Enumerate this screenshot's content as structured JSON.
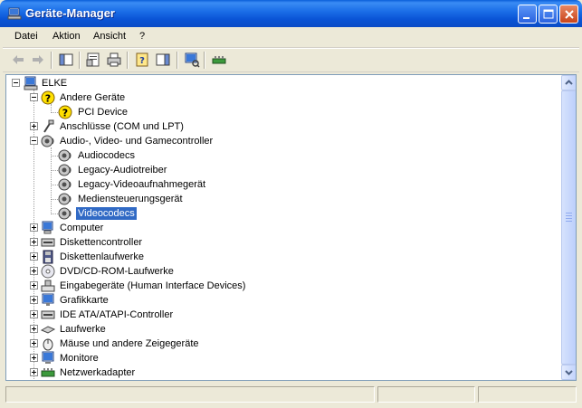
{
  "window": {
    "title": "Geräte-Manager"
  },
  "menu": [
    {
      "label": "Datei"
    },
    {
      "label": "Aktion"
    },
    {
      "label": "Ansicht"
    },
    {
      "label": "?"
    }
  ],
  "toolbar": {
    "buttons": [
      {
        "name": "back-icon"
      },
      {
        "name": "forward-icon"
      },
      {
        "name": "show-hide-console-tree-icon"
      },
      {
        "name": "properties-icon"
      },
      {
        "name": "print-icon"
      },
      {
        "name": "help-icon"
      },
      {
        "name": "show-hide-action-pane-icon"
      },
      {
        "name": "scan-hardware-changes-icon"
      },
      {
        "name": "update-driver-icon"
      }
    ]
  },
  "tree": {
    "root": {
      "label": "ELKE",
      "icon": "computer-icon",
      "expanded": true
    },
    "nodes": [
      {
        "label": "Andere Geräte",
        "icon": "unknown-device-icon",
        "level": 1,
        "expanded": true,
        "has_children": true
      },
      {
        "label": "PCI Device",
        "icon": "unknown-device-icon",
        "level": 2
      },
      {
        "label": "Anschlüsse (COM und LPT)",
        "icon": "port-icon",
        "level": 1,
        "expanded": false,
        "has_children": true
      },
      {
        "label": "Audio-, Video- und Gamecontroller",
        "icon": "sound-icon",
        "level": 1,
        "expanded": true,
        "has_children": true
      },
      {
        "label": "Audiocodecs",
        "icon": "sound-icon",
        "level": 2
      },
      {
        "label": "Legacy-Audiotreiber",
        "icon": "sound-icon",
        "level": 2
      },
      {
        "label": "Legacy-Videoaufnahmegerät",
        "icon": "sound-icon",
        "level": 2
      },
      {
        "label": "Mediensteuerungsgerät",
        "icon": "sound-icon",
        "level": 2
      },
      {
        "label": "Videocodecs",
        "icon": "sound-icon",
        "level": 2,
        "selected": true
      },
      {
        "label": "Computer",
        "icon": "computer-small-icon",
        "level": 1,
        "expanded": false,
        "has_children": true
      },
      {
        "label": "Diskettencontroller",
        "icon": "floppy-controller-icon",
        "level": 1,
        "expanded": false,
        "has_children": true
      },
      {
        "label": "Diskettenlaufwerke",
        "icon": "floppy-drive-icon",
        "level": 1,
        "expanded": false,
        "has_children": true
      },
      {
        "label": "DVD/CD-ROM-Laufwerke",
        "icon": "cdrom-icon",
        "level": 1,
        "expanded": false,
        "has_children": true
      },
      {
        "label": "Eingabegeräte (Human Interface Devices)",
        "icon": "hid-icon",
        "level": 1,
        "expanded": false,
        "has_children": true
      },
      {
        "label": "Grafikkarte",
        "icon": "display-adapter-icon",
        "level": 1,
        "expanded": false,
        "has_children": true
      },
      {
        "label": "IDE ATA/ATAPI-Controller",
        "icon": "ide-controller-icon",
        "level": 1,
        "expanded": false,
        "has_children": true
      },
      {
        "label": "Laufwerke",
        "icon": "disk-drive-icon",
        "level": 1,
        "expanded": false,
        "has_children": true
      },
      {
        "label": "Mäuse und andere Zeigegeräte",
        "icon": "mouse-icon",
        "level": 1,
        "expanded": false,
        "has_children": true
      },
      {
        "label": "Monitore",
        "icon": "monitor-icon",
        "level": 1,
        "expanded": false,
        "has_children": true
      },
      {
        "label": "Netzwerkadapter",
        "icon": "network-adapter-icon",
        "level": 1,
        "expanded": false,
        "has_children": true
      }
    ]
  },
  "colors": {
    "titlebar": "#0a54d6",
    "selection": "#316ac5",
    "window_bg": "#ece9d8"
  }
}
